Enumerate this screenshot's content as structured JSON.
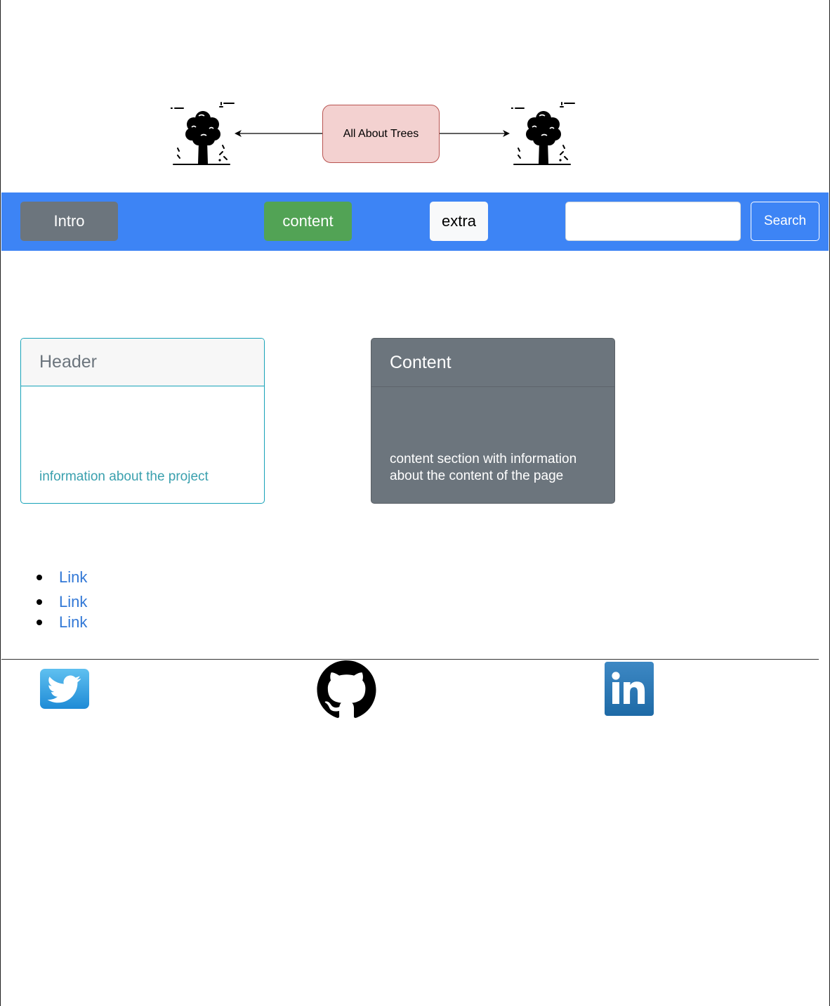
{
  "diagram": {
    "title": "All About Trees",
    "left_icon": "tree-icon",
    "right_icon": "tree-icon",
    "box_fill": "#f3d1d0",
    "box_border": "#b85450"
  },
  "navbar": {
    "background": "#3d84f5",
    "buttons": [
      {
        "label": "Intro"
      },
      {
        "label": "content"
      },
      {
        "label": "extra"
      }
    ],
    "search": {
      "value": "",
      "placeholder": "",
      "button_label": "Search"
    }
  },
  "cards": [
    {
      "header": "Header",
      "body": "information about the project",
      "accent": "#17a2b8"
    },
    {
      "header": "Content",
      "body": "content section with information about the content of the page",
      "accent": "#6c757d"
    }
  ],
  "links": [
    {
      "label": "Link"
    },
    {
      "label": "Link"
    },
    {
      "label": "Link"
    }
  ],
  "social": {
    "icons": [
      "twitter-icon",
      "github-icon",
      "linkedin-icon"
    ]
  }
}
